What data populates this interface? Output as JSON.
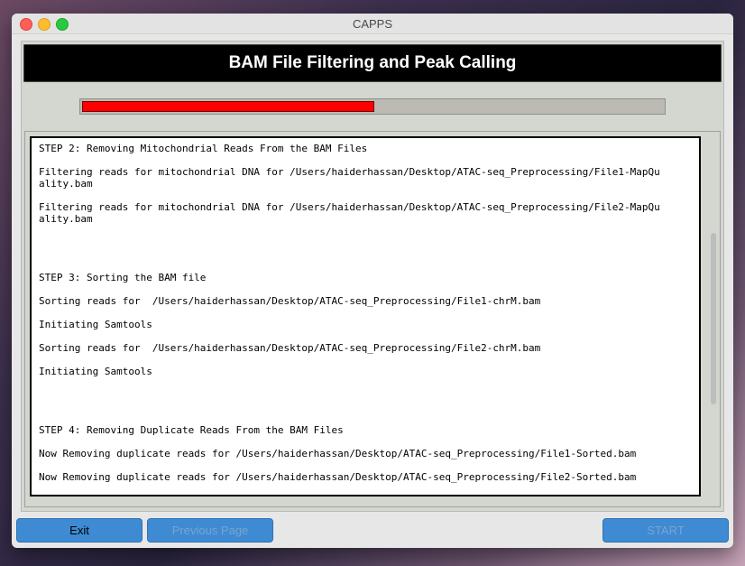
{
  "window": {
    "title": "CAPPS"
  },
  "banner": {
    "title": "BAM File Filtering and Peak Calling"
  },
  "progress": {
    "fraction": 0.5,
    "color": "#ff0000"
  },
  "log": {
    "lines": [
      "",
      "STEP 2: Removing Mitochondrial Reads From the BAM Files",
      "",
      "Filtering reads for mitochondrial DNA for /Users/haiderhassan/Desktop/ATAC-seq_Preprocessing/File1-MapQu",
      "ality.bam",
      "",
      "Filtering reads for mitochondrial DNA for /Users/haiderhassan/Desktop/ATAC-seq_Preprocessing/File2-MapQu",
      "ality.bam",
      "",
      "",
      "",
      "",
      "STEP 3: Sorting the BAM file",
      "",
      "Sorting reads for  /Users/haiderhassan/Desktop/ATAC-seq_Preprocessing/File1-chrM.bam",
      "",
      "Initiating Samtools",
      "",
      "Sorting reads for  /Users/haiderhassan/Desktop/ATAC-seq_Preprocessing/File2-chrM.bam",
      "",
      "Initiating Samtools",
      "",
      "",
      "",
      "",
      "STEP 4: Removing Duplicate Reads From the BAM Files",
      "",
      "Now Removing duplicate reads for /Users/haiderhassan/Desktop/ATAC-seq_Preprocessing/File1-Sorted.bam",
      "",
      "Now Removing duplicate reads for /Users/haiderhassan/Desktop/ATAC-seq_Preprocessing/File2-Sorted.bam"
    ]
  },
  "buttons": {
    "exit": "Exit",
    "previous": "Previous Page",
    "start": "START"
  }
}
